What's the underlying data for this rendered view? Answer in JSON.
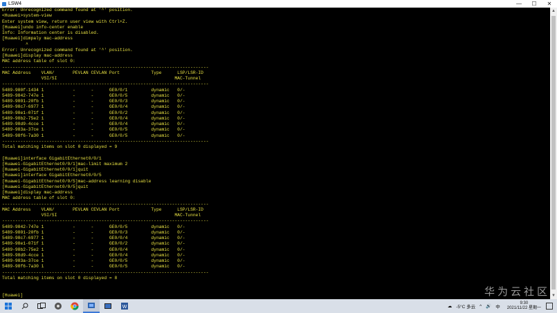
{
  "window": {
    "title": "LSW4",
    "minimize": "—",
    "maximize": "☐",
    "close": "✕"
  },
  "terminal_lines": [
    "Error: Unrecognized command found at '^' position.",
    "<Huawei>system-view",
    "Enter system view, return user view with Ctrl+Z.",
    "[Huawei]undo info-center enable",
    "Info: Information center is disabled.",
    "[Huawei]dimpaly mac-address",
    "         ^",
    "Error: Unrecognized command found at '^' position.",
    "[Huawei]display mac-address",
    "MAC address table of slot 0:",
    "-------------------------------------------------------------------------------",
    "MAC Address    VLAN/       PEVLAN CEVLAN Port            Type      LSP/LSR-ID",
    "               VSI/SI                                             MAC-Tunnel",
    "-------------------------------------------------------------------------------",
    "5489-980f-1434 1           -      -      GE0/0/1         dynamic   0/-",
    "5489-9842-747e 1           -      -      GE0/0/5         dynamic   0/-",
    "5489-9801-20fb 1           -      -      GE0/0/3         dynamic   0/-",
    "5489-98c7-6977 1           -      -      GE0/0/4         dynamic   0/-",
    "5489-98e1-071f 1           -      -      GE0/0/2         dynamic   0/-",
    "5489-98b2-75e2 1           -      -      GE0/0/4         dynamic   0/-",
    "5489-98d9-4cce 1           -      -      GE0/0/4         dynamic   0/-",
    "5489-983a-37ce 1           -      -      GE0/0/5         dynamic   0/-",
    "5489-98f6-7a30 1           -      -      GE0/0/5         dynamic   0/-",
    "-------------------------------------------------------------------------------",
    "Total matching items on slot 0 displayed = 9",
    "",
    "[Huawei]interface GigabitEthernet0/0/1",
    "[Huawei-GigabitEthernet0/0/1]mac-limit maximum 2",
    "[Huawei-GigabitEthernet0/0/1]quit",
    "[Huawei]interface GigabitEthernet0/0/5",
    "[Huawei-GigabitEthernet0/0/5]mac-address learning disable",
    "[Huawei-GigabitEthernet0/0/5]quit",
    "[Huawei]display mac-address",
    "MAC address table of slot 0:",
    "-------------------------------------------------------------------------------",
    "MAC Address    VLAN/       PEVLAN CEVLAN Port            Type      LSP/LSR-ID",
    "               VSI/SI                                             MAC-Tunnel",
    "-------------------------------------------------------------------------------",
    "5489-9842-747e 1           -      -      GE0/0/5         dynamic   0/-",
    "5489-9801-20fb 1           -      -      GE0/0/3         dynamic   0/-",
    "5489-98c7-6977 1           -      -      GE0/0/4         dynamic   0/-",
    "5489-98e1-071f 1           -      -      GE0/0/2         dynamic   0/-",
    "5489-98b2-75e2 1           -      -      GE0/0/4         dynamic   0/-",
    "5489-98d9-4cce 1           -      -      GE0/0/4         dynamic   0/-",
    "5489-983a-37ce 1           -      -      GE0/0/5         dynamic   0/-",
    "5489-98f6-7a30 1           -      -      GE0/0/5         dynamic   0/-",
    "-------------------------------------------------------------------------------",
    "Total matching items on slot 0 displayed = 8",
    "",
    "",
    "[Huawei]"
  ],
  "watermark": "华为云社区",
  "taskbar": {
    "icons": [
      "windows-start-icon",
      "search-icon",
      "task-view-icon",
      "app-icon",
      "chrome-icon",
      "ensp-icon",
      "terminal-icon",
      "word-icon"
    ],
    "weather": "-5°C 多云",
    "ime": "中",
    "time": "9:30",
    "date": "2021/11/22 星期一",
    "colors": {
      "taskbar": "#d9dfe8",
      "terminal_text": "#e7e042"
    }
  }
}
